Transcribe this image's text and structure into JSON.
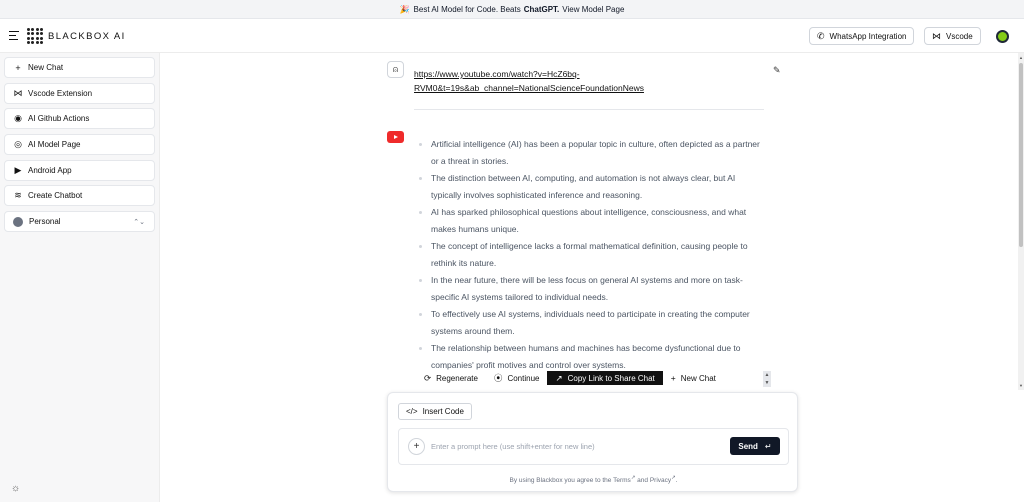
{
  "banner": {
    "prefix": "Best AI Model for Code. Beats",
    "highlight": "ChatGPT.",
    "link": "View Model Page",
    "icon": "sparkle-icon"
  },
  "header": {
    "logo_text": "BLACKBOX AI",
    "whatsapp_label": "WhatsApp Integration",
    "vscode_label": "Vscode"
  },
  "sidebar": {
    "items": [
      {
        "label": "New Chat",
        "icon": "plus-icon"
      },
      {
        "label": "Vscode Extension",
        "icon": "vscode-icon"
      },
      {
        "label": "AI Github Actions",
        "icon": "github-icon"
      },
      {
        "label": "AI Model Page",
        "icon": "target-icon"
      },
      {
        "label": "Android App",
        "icon": "play-store-icon"
      },
      {
        "label": "Create Chatbot",
        "icon": "layers-icon"
      },
      {
        "label": "Personal",
        "icon": "avatar"
      }
    ]
  },
  "chat": {
    "user_message": "https://www.youtube.com/watch?v=HcZ6bq-RVM0&t=19s&ab_channel=NationalScienceFoundationNews",
    "bullets": [
      "Artificial intelligence (AI) has been a popular topic in culture, often depicted as a partner or a threat in stories.",
      "The distinction between AI, computing, and automation is not always clear, but AI typically involves sophisticated inference and reasoning.",
      "AI has sparked philosophical questions about intelligence, consciousness, and what makes humans unique.",
      "The concept of intelligence lacks a formal mathematical definition, causing people to rethink its nature.",
      "In the near future, there will be less focus on general AI systems and more on task-specific AI systems tailored to individual needs.",
      "To effectively use AI systems, individuals need to participate in creating the computer systems around them.",
      "The relationship between humans and machines has become dysfunctional due to companies' profit motives and control over systems."
    ]
  },
  "actions": {
    "regenerate": "Regenerate",
    "continue": "Continue",
    "copy_link": "Copy Link to Share Chat",
    "new_chat": "New Chat"
  },
  "composer": {
    "insert_code": "Insert Code",
    "placeholder": "Enter a prompt here (use shift+enter for new line)",
    "send": "Send",
    "terms_prefix": "By using Blackbox you agree to the",
    "terms_link": "Terms",
    "and": "and",
    "privacy_link": "Privacy",
    "terms_suffix": "."
  },
  "colors": {
    "youtube_red": "#ef2b2b",
    "send_bg": "#111827",
    "avatar_green": "#84cc16"
  }
}
